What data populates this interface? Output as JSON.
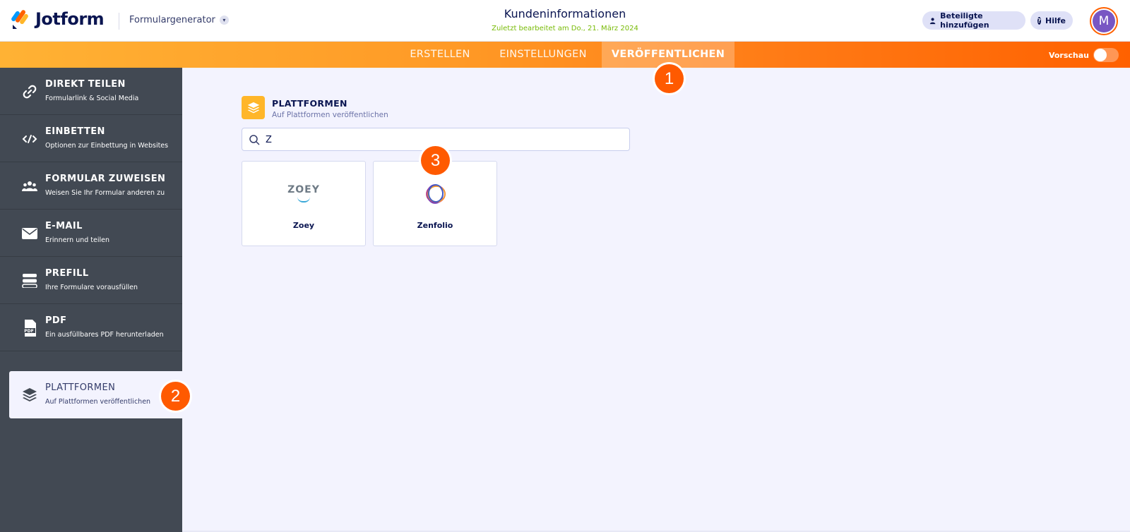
{
  "header": {
    "logo_text": "Jotform",
    "builder_label": "Formulargenerator",
    "form_title": "Kundeninformationen",
    "last_edited": "Zuletzt bearbeitet am Do., 21. März 2024",
    "add_contributors": "Beteiligte hinzufügen",
    "help": "Hilfe",
    "avatar_initial": "M"
  },
  "nav": {
    "tabs": [
      {
        "label": "ERSTELLEN"
      },
      {
        "label": "EINSTELLUNGEN"
      },
      {
        "label": "VERÖFFENTLICHEN",
        "active": true
      }
    ],
    "preview_label": "Vorschau",
    "preview_on": false
  },
  "sidebar": {
    "items": [
      {
        "title": "DIREKT TEILEN",
        "subtitle": "Formularlink & Social Media",
        "icon": "link-icon"
      },
      {
        "title": "EINBETTEN",
        "subtitle": "Optionen zur Einbettung in Websites",
        "icon": "code-icon"
      },
      {
        "title": "FORMULAR ZUWEISEN",
        "subtitle": "Weisen Sie Ihr Formular anderen zu",
        "icon": "users-icon"
      },
      {
        "title": "E-MAIL",
        "subtitle": "Erinnern und teilen",
        "icon": "envelope-icon"
      },
      {
        "title": "PREFILL",
        "subtitle": "Ihre Formulare vorausfüllen",
        "icon": "prefill-icon"
      },
      {
        "title": "PDF",
        "subtitle": "Ein ausfüllbares PDF herunterladen",
        "icon": "pdf-icon"
      },
      {
        "title": "PLATTFORMEN",
        "subtitle": "Auf Plattformen veröffentlichen",
        "icon": "layers-icon",
        "active": true
      }
    ]
  },
  "main": {
    "section_title": "PLATTFORMEN",
    "section_subtitle": "Auf Plattformen veröffentlichen",
    "search_value": "Z",
    "cards": [
      {
        "label": "Zoey",
        "logo_text": "ZOEY",
        "icon": "zoey-logo"
      },
      {
        "label": "Zenfolio",
        "icon": "zenfolio-logo"
      }
    ]
  },
  "markers": [
    "1",
    "2",
    "3"
  ],
  "colors": {
    "accent": "#ff6100",
    "sidebar_bg": "#424953",
    "nav_gradient_start": "#ffb234",
    "edited_green": "#78bb07"
  }
}
